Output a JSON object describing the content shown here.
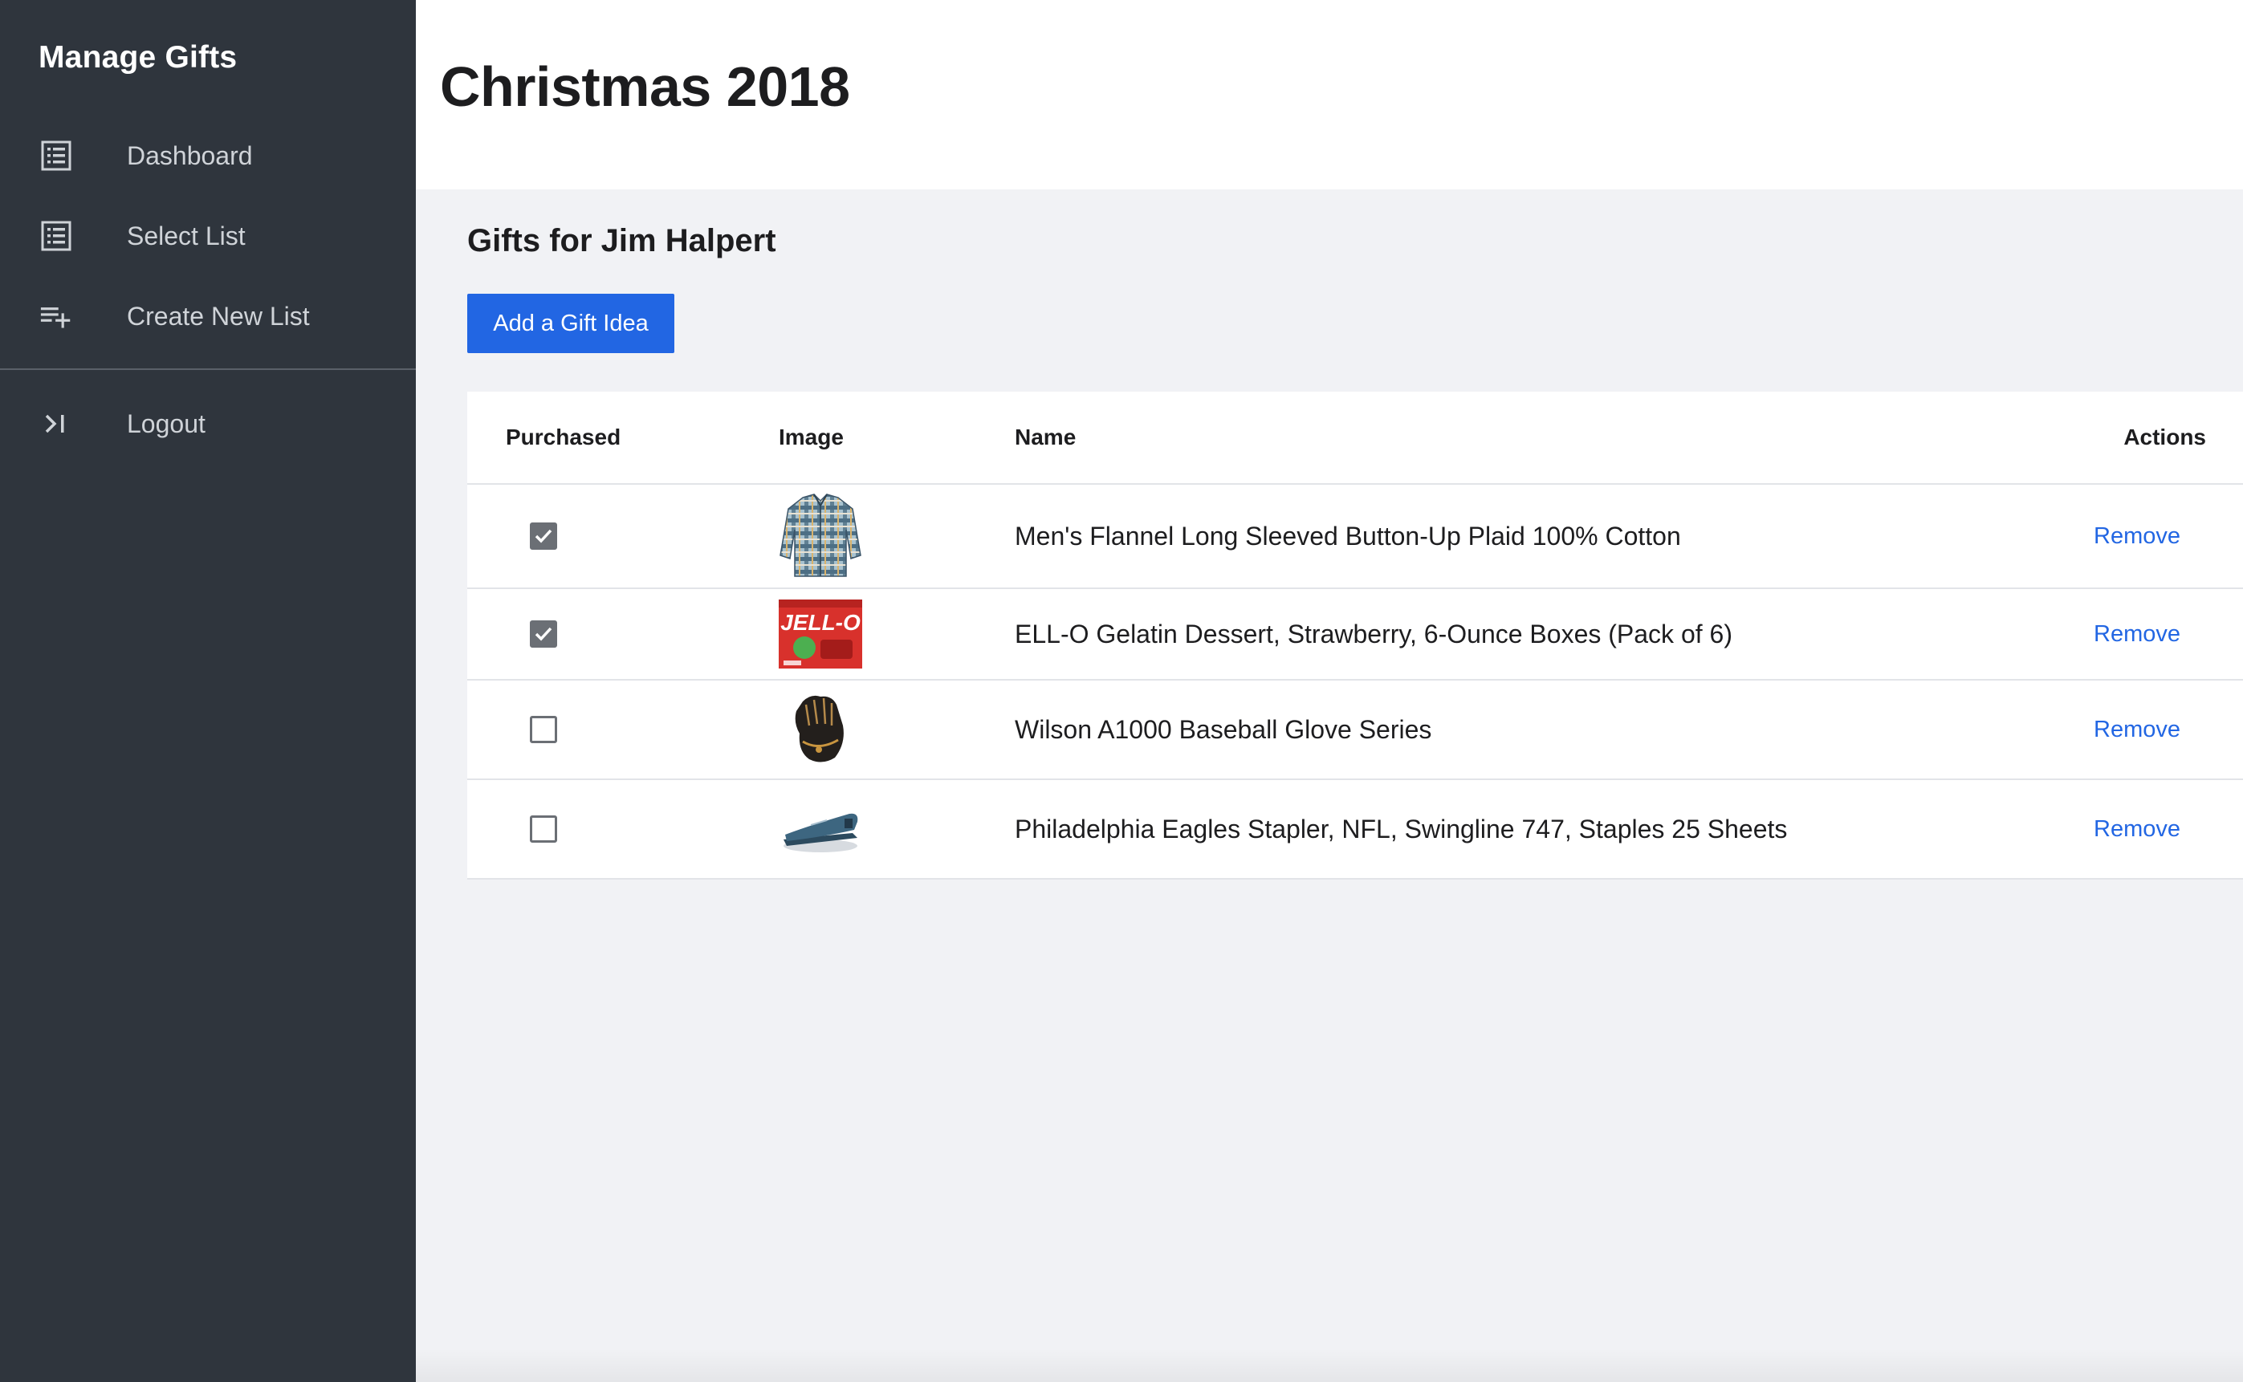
{
  "sidebar": {
    "brand": "Manage Gifts",
    "items": [
      {
        "label": "Dashboard",
        "icon": "list-icon"
      },
      {
        "label": "Select List",
        "icon": "list-icon"
      },
      {
        "label": "Create New List",
        "icon": "playlist-add-icon"
      }
    ],
    "logout": {
      "label": "Logout",
      "icon": "logout-icon"
    }
  },
  "header": {
    "title": "Christmas 2018"
  },
  "main": {
    "section_title": "Gifts for Jim Halpert",
    "add_button_label": "Add a Gift Idea",
    "table": {
      "headers": {
        "purchased": "Purchased",
        "image": "Image",
        "name": "Name",
        "actions": "Actions"
      },
      "rows": [
        {
          "purchased": true,
          "image": "flannel-shirt-image",
          "name": "Men's Flannel Long Sleeved Button-Up Plaid 100% Cotton",
          "action": "Remove"
        },
        {
          "purchased": true,
          "image": "jello-box-image",
          "name": "ELL-O Gelatin Dessert, Strawberry, 6-Ounce Boxes (Pack of 6)",
          "action": "Remove"
        },
        {
          "purchased": false,
          "image": "baseball-glove-image",
          "name": "Wilson A1000 Baseball Glove Series",
          "action": "Remove"
        },
        {
          "purchased": false,
          "image": "stapler-image",
          "name": "Philadelphia Eagles Stapler, NFL, Swingline 747, Staples 25 Sheets",
          "action": "Remove"
        }
      ]
    }
  },
  "colors": {
    "sidebar_bg": "#2f353d",
    "accent": "#2266e3",
    "page_bg": "#f1f2f5"
  }
}
